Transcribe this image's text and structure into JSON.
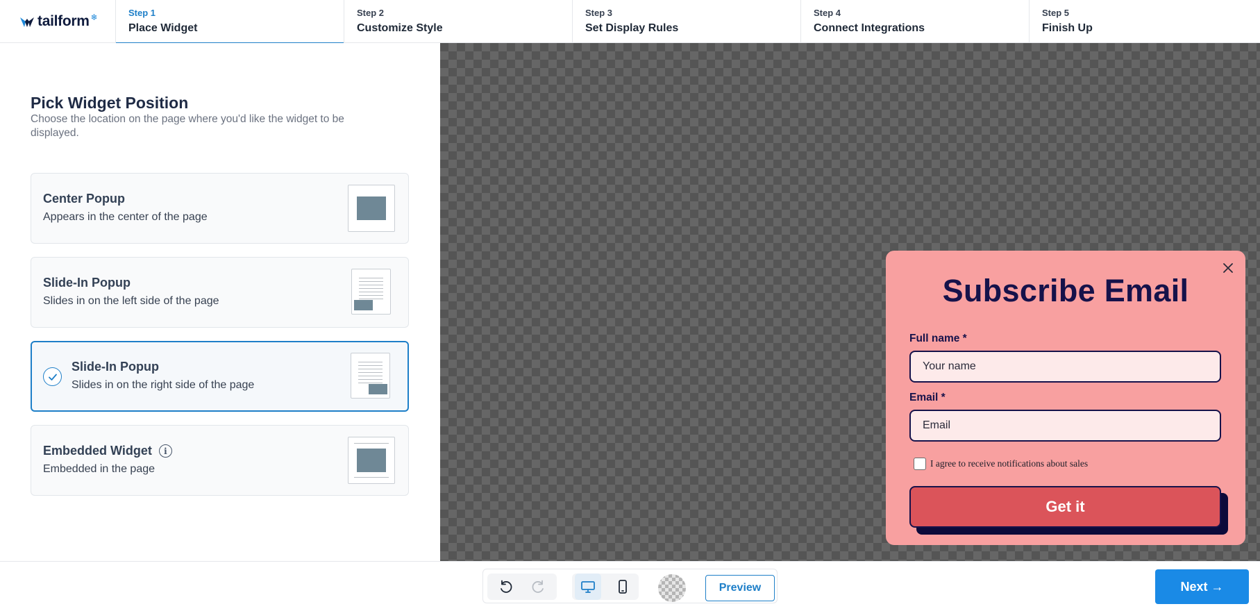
{
  "brand": {
    "name": "tailform",
    "star": "❄"
  },
  "steps": [
    {
      "num": "Step 1",
      "title": "Place Widget",
      "active": true
    },
    {
      "num": "Step 2",
      "title": "Customize Style"
    },
    {
      "num": "Step 3",
      "title": "Set Display Rules"
    },
    {
      "num": "Step 4",
      "title": "Connect Integrations"
    },
    {
      "num": "Step 5",
      "title": "Finish Up"
    }
  ],
  "panel": {
    "title": "Pick Widget Position",
    "description": "Choose the location on the page where you'd like the widget to be displayed."
  },
  "options": [
    {
      "title": "Center Popup",
      "subtitle": "Appears in the center of the page",
      "thumb": "center"
    },
    {
      "title": "Slide-In Popup",
      "subtitle": "Slides in on the left side of the page",
      "thumb": "slide-left"
    },
    {
      "title": "Slide-In Popup",
      "subtitle": "Slides in on the right side of the page",
      "thumb": "slide-right",
      "selected": true
    },
    {
      "title": "Embedded Widget",
      "subtitle": "Embedded in the page",
      "thumb": "embedded",
      "info_icon": "info-icon"
    }
  ],
  "widget": {
    "title": "Subscribe Email",
    "name_label": "Full name *",
    "name_placeholder": "Your name",
    "email_label": "Email *",
    "email_placeholder": "Email",
    "consent_label": "I agree to receive notifications about sales",
    "button_label": "Get it",
    "colors": {
      "background": "#f8a0a0",
      "text": "#16124a",
      "button": "#db545a"
    }
  },
  "footer": {
    "preview_label": "Preview",
    "next_label": "Next →",
    "icons": [
      "undo-icon",
      "redo-icon",
      "desktop-icon",
      "mobile-icon",
      "transparent-background-icon"
    ]
  },
  "colors": {
    "accent": "#1e7fc8",
    "next_button": "#1a8ae6"
  }
}
